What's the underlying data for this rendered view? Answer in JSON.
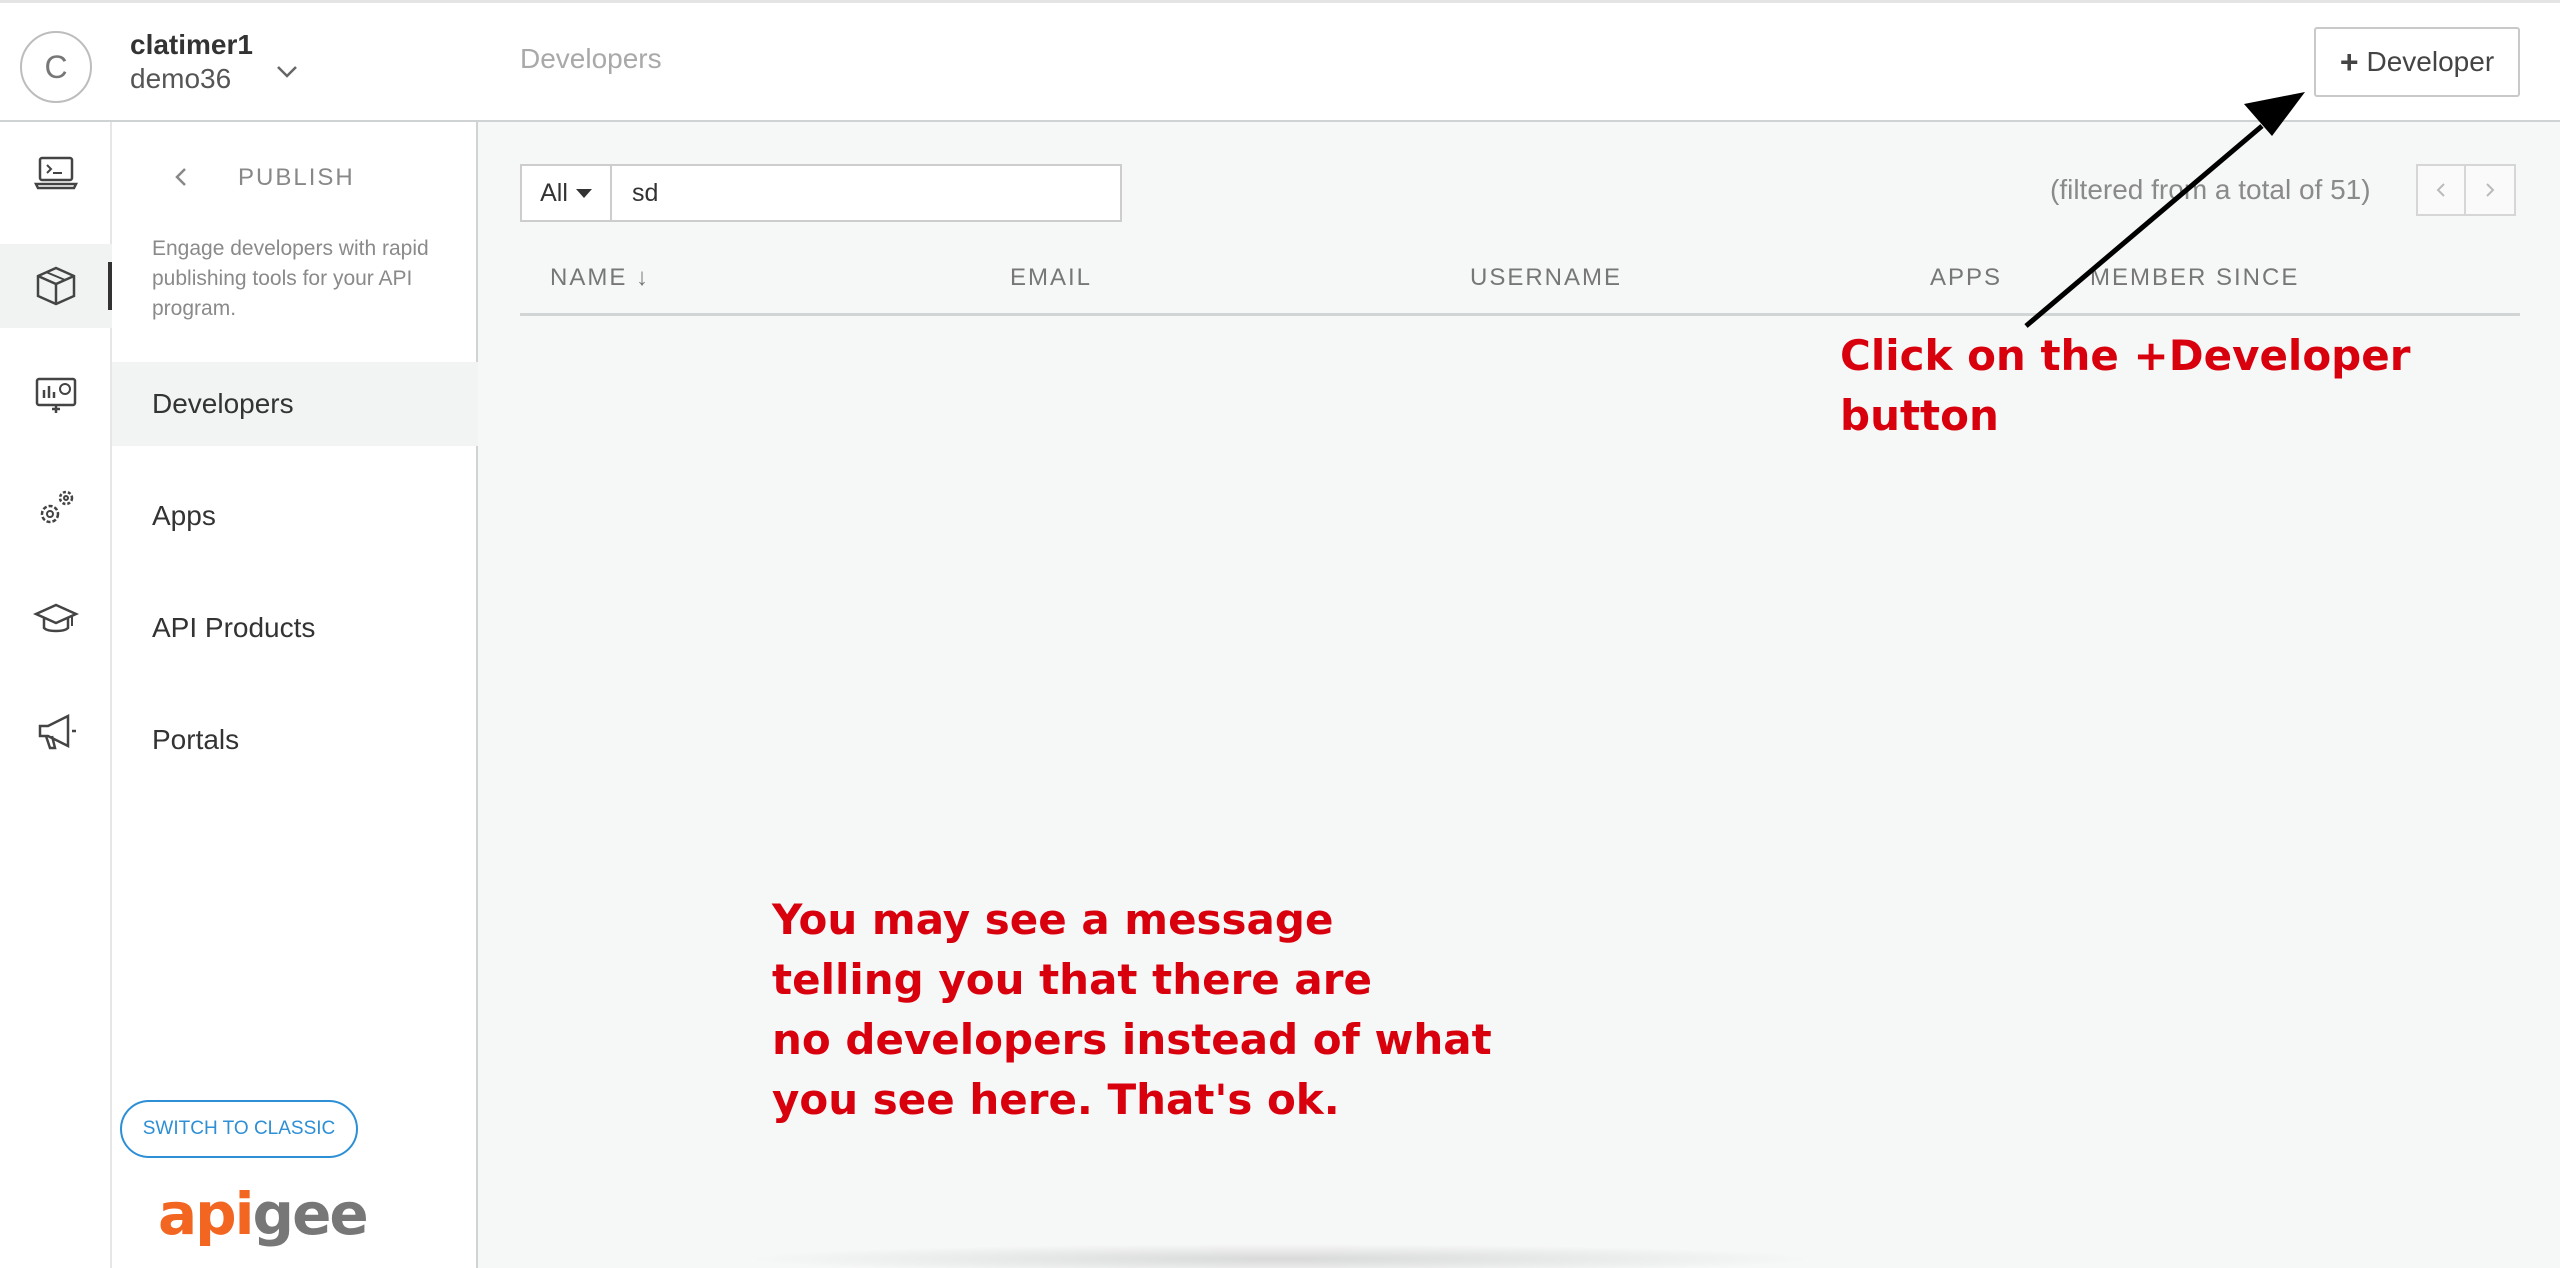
{
  "header": {
    "avatar_initial": "C",
    "user_name": "clatimer1",
    "org_name": "demo36",
    "title": "Developers",
    "add_button_plus": "+",
    "add_button_label": "Developer"
  },
  "rail": {
    "items": [
      {
        "icon": "terminal-laptop-icon"
      },
      {
        "icon": "package-box-icon",
        "active": true
      },
      {
        "icon": "analytics-monitor-icon"
      },
      {
        "icon": "gears-icon"
      },
      {
        "icon": "graduation-cap-icon"
      },
      {
        "icon": "megaphone-icon"
      }
    ]
  },
  "subnav": {
    "section_title": "PUBLISH",
    "section_desc": "Engage developers with rapid publishing tools for your API program.",
    "items": [
      {
        "label": "Developers",
        "active": true
      },
      {
        "label": "Apps"
      },
      {
        "label": "API Products"
      },
      {
        "label": "Portals"
      }
    ],
    "switch_label": "SWITCH TO CLASSIC",
    "logo_a": "api",
    "logo_b": "gee"
  },
  "filter": {
    "select_value": "All",
    "search_value": "sd",
    "status": "(filtered from a total of 51)"
  },
  "table": {
    "columns": [
      "NAME ↓",
      "EMAIL",
      "USERNAME",
      "APPS",
      "MEMBER SINCE"
    ]
  },
  "annotations": {
    "top_right": [
      "Click on the +Developer",
      "button"
    ],
    "bottom": [
      "You may see a message",
      "telling you that there are",
      "no developers instead of what",
      "you see here. That's ok."
    ]
  },
  "colors": {
    "accent_blue": "#2d8fd5",
    "annotation_red": "#d9000d",
    "logo_orange": "#f26622"
  }
}
